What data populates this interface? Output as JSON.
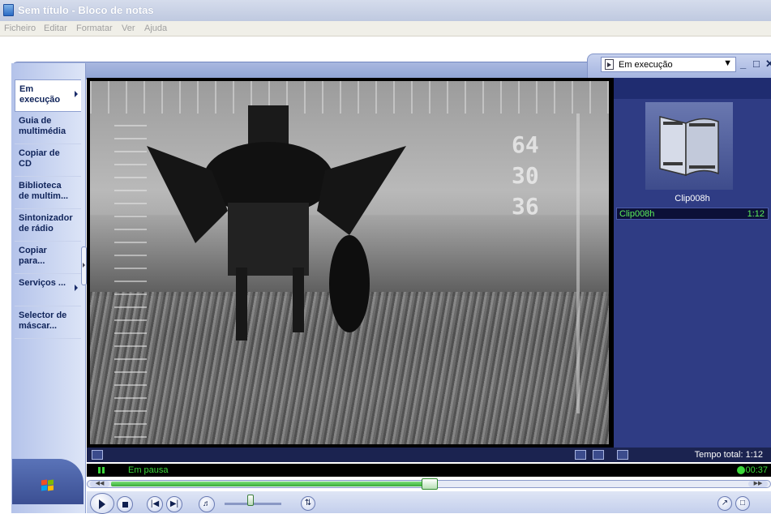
{
  "notepad": {
    "title": "Sem título - Bloco de notas",
    "menu": [
      "Ficheiro",
      "Editar",
      "Formatar",
      "Ver",
      "Ajuda"
    ]
  },
  "wmp": {
    "now_playing_select": "Em execução",
    "window_buttons": {
      "minimize": "_",
      "maximize": "□",
      "close": "✕"
    },
    "sidebar": [
      {
        "label": "Em execução",
        "active": true,
        "has_arrow": true
      },
      {
        "label": "Guia de multimédia",
        "active": false,
        "has_arrow": false
      },
      {
        "label": "Copiar de CD",
        "active": false,
        "has_arrow": false
      },
      {
        "label": "Biblioteca de multim...",
        "active": false,
        "has_arrow": false
      },
      {
        "label": "Sintonizador de rádio",
        "active": false,
        "has_arrow": false
      },
      {
        "label": "Copiar para...",
        "active": false,
        "has_arrow": false
      },
      {
        "label": "Serviços ...",
        "active": false,
        "has_arrow": true
      },
      {
        "label": "Selector de máscar...",
        "active": false,
        "has_arrow": false
      }
    ],
    "video_overlay_numbers": [
      "64",
      "30",
      "36"
    ],
    "playlist": {
      "thumb_label": "Clip008h",
      "items": [
        {
          "name": "Clip008h",
          "duration": "1:12"
        }
      ],
      "total": "Tempo total: 1:12"
    },
    "status": {
      "state": "Em pausa",
      "time": "00:37"
    },
    "seek": {
      "progress": 0.51
    },
    "volume": {
      "level": 0.45
    },
    "colors": {
      "status_green": "#3bd83a",
      "playlist_bg": "#2f3c84",
      "accent": "#8ea2d4"
    }
  }
}
